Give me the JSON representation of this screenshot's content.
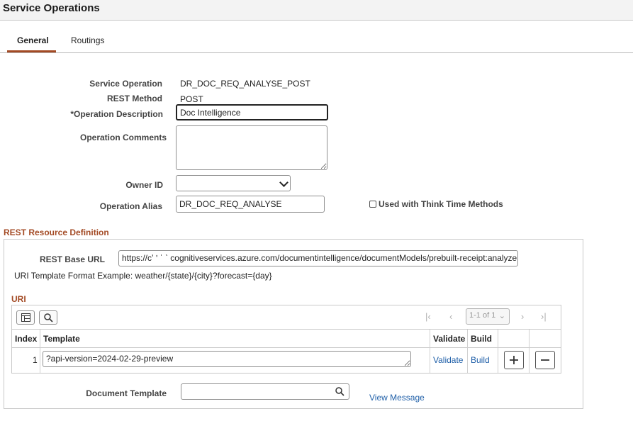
{
  "page": {
    "title": "Service Operations"
  },
  "tabs": [
    {
      "label": "General"
    },
    {
      "label": "Routings"
    }
  ],
  "form": {
    "service_operation_label": "Service Operation",
    "service_operation_value": "DR_DOC_REQ_ANALYSE_POST",
    "rest_method_label": "REST Method",
    "rest_method_value": "POST",
    "operation_description_label": "*Operation Description",
    "operation_description_value": "Doc Intelligence",
    "operation_comments_label": "Operation Comments",
    "operation_comments_value": "",
    "owner_id_label": "Owner ID",
    "owner_id_value": "",
    "operation_alias_label": "Operation Alias",
    "operation_alias_value": "DR_DOC_REQ_ANALYSE",
    "think_time_label": "Used with Think Time Methods"
  },
  "rest_resource": {
    "section_title": "REST Resource Definition",
    "base_url_label": "REST Base URL",
    "base_url_value": "https://cʼ     ʹ ˈ ˋ cognitiveservices.azure.com/documentintelligence/documentModels/prebuilt-receipt:analyze",
    "template_example": "URI Template Format Example: weather/{state}/{city}?forecast={day}",
    "uri_title": "URI",
    "grid": {
      "pager_text": "1-1 of 1",
      "columns": [
        "Index",
        "Template",
        "Validate",
        "Build"
      ],
      "rows": [
        {
          "index": "1",
          "template": "?api-version=2024-02-29-preview",
          "validate": "Validate",
          "build": "Build"
        }
      ]
    },
    "document_template_label": "Document Template",
    "document_template_value": "",
    "view_message_label": "View Message"
  },
  "icons": {
    "grid_view": "grid-view-icon",
    "search": "search-icon",
    "first": "first-page-icon",
    "prev": "prev-page-icon",
    "next": "next-page-icon",
    "last": "last-page-icon",
    "add": "plus-icon",
    "remove": "minus-icon"
  },
  "colors": {
    "accent": "#a34a24",
    "link": "#1f5fa8"
  }
}
